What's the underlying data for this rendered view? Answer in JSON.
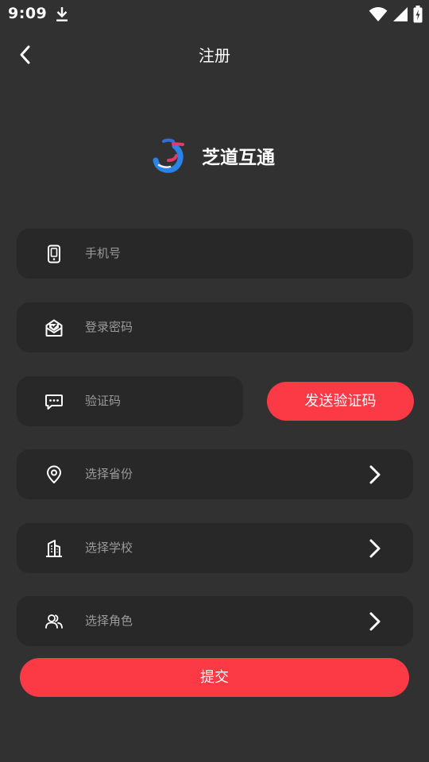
{
  "status_bar": {
    "time": "9:09"
  },
  "header": {
    "title": "注册"
  },
  "brand": {
    "name": "芝道互通"
  },
  "form": {
    "phone_placeholder": "手机号",
    "password_placeholder": "登录密码",
    "code_placeholder": "验证码",
    "send_code_label": "发送验证码",
    "province_placeholder": "选择省份",
    "school_placeholder": "选择学校",
    "role_placeholder": "选择角色",
    "submit_label": "提交"
  },
  "colors": {
    "background": "#313131",
    "field_background": "#282828",
    "accent": "#fc3a45",
    "placeholder_text": "#9a9a9a",
    "text": "#ffffff"
  }
}
